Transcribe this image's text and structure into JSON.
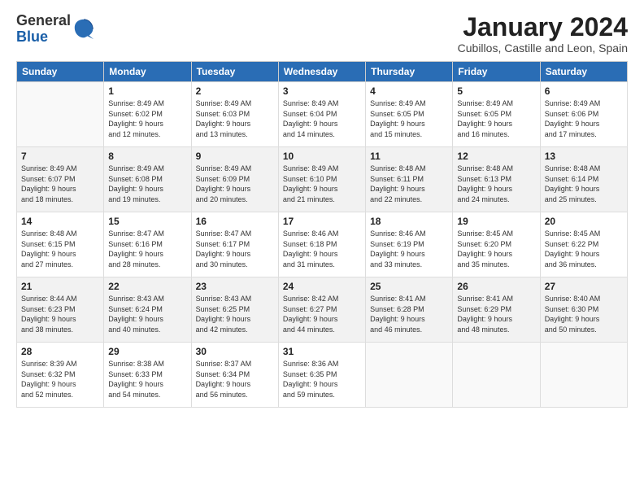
{
  "header": {
    "logo_line1": "General",
    "logo_line2": "Blue",
    "month": "January 2024",
    "location": "Cubillos, Castille and Leon, Spain"
  },
  "days_of_week": [
    "Sunday",
    "Monday",
    "Tuesday",
    "Wednesday",
    "Thursday",
    "Friday",
    "Saturday"
  ],
  "weeks": [
    [
      {
        "num": "",
        "info": ""
      },
      {
        "num": "1",
        "info": "Sunrise: 8:49 AM\nSunset: 6:02 PM\nDaylight: 9 hours\nand 12 minutes."
      },
      {
        "num": "2",
        "info": "Sunrise: 8:49 AM\nSunset: 6:03 PM\nDaylight: 9 hours\nand 13 minutes."
      },
      {
        "num": "3",
        "info": "Sunrise: 8:49 AM\nSunset: 6:04 PM\nDaylight: 9 hours\nand 14 minutes."
      },
      {
        "num": "4",
        "info": "Sunrise: 8:49 AM\nSunset: 6:05 PM\nDaylight: 9 hours\nand 15 minutes."
      },
      {
        "num": "5",
        "info": "Sunrise: 8:49 AM\nSunset: 6:05 PM\nDaylight: 9 hours\nand 16 minutes."
      },
      {
        "num": "6",
        "info": "Sunrise: 8:49 AM\nSunset: 6:06 PM\nDaylight: 9 hours\nand 17 minutes."
      }
    ],
    [
      {
        "num": "7",
        "info": "Sunrise: 8:49 AM\nSunset: 6:07 PM\nDaylight: 9 hours\nand 18 minutes."
      },
      {
        "num": "8",
        "info": "Sunrise: 8:49 AM\nSunset: 6:08 PM\nDaylight: 9 hours\nand 19 minutes."
      },
      {
        "num": "9",
        "info": "Sunrise: 8:49 AM\nSunset: 6:09 PM\nDaylight: 9 hours\nand 20 minutes."
      },
      {
        "num": "10",
        "info": "Sunrise: 8:49 AM\nSunset: 6:10 PM\nDaylight: 9 hours\nand 21 minutes."
      },
      {
        "num": "11",
        "info": "Sunrise: 8:48 AM\nSunset: 6:11 PM\nDaylight: 9 hours\nand 22 minutes."
      },
      {
        "num": "12",
        "info": "Sunrise: 8:48 AM\nSunset: 6:13 PM\nDaylight: 9 hours\nand 24 minutes."
      },
      {
        "num": "13",
        "info": "Sunrise: 8:48 AM\nSunset: 6:14 PM\nDaylight: 9 hours\nand 25 minutes."
      }
    ],
    [
      {
        "num": "14",
        "info": "Sunrise: 8:48 AM\nSunset: 6:15 PM\nDaylight: 9 hours\nand 27 minutes."
      },
      {
        "num": "15",
        "info": "Sunrise: 8:47 AM\nSunset: 6:16 PM\nDaylight: 9 hours\nand 28 minutes."
      },
      {
        "num": "16",
        "info": "Sunrise: 8:47 AM\nSunset: 6:17 PM\nDaylight: 9 hours\nand 30 minutes."
      },
      {
        "num": "17",
        "info": "Sunrise: 8:46 AM\nSunset: 6:18 PM\nDaylight: 9 hours\nand 31 minutes."
      },
      {
        "num": "18",
        "info": "Sunrise: 8:46 AM\nSunset: 6:19 PM\nDaylight: 9 hours\nand 33 minutes."
      },
      {
        "num": "19",
        "info": "Sunrise: 8:45 AM\nSunset: 6:20 PM\nDaylight: 9 hours\nand 35 minutes."
      },
      {
        "num": "20",
        "info": "Sunrise: 8:45 AM\nSunset: 6:22 PM\nDaylight: 9 hours\nand 36 minutes."
      }
    ],
    [
      {
        "num": "21",
        "info": "Sunrise: 8:44 AM\nSunset: 6:23 PM\nDaylight: 9 hours\nand 38 minutes."
      },
      {
        "num": "22",
        "info": "Sunrise: 8:43 AM\nSunset: 6:24 PM\nDaylight: 9 hours\nand 40 minutes."
      },
      {
        "num": "23",
        "info": "Sunrise: 8:43 AM\nSunset: 6:25 PM\nDaylight: 9 hours\nand 42 minutes."
      },
      {
        "num": "24",
        "info": "Sunrise: 8:42 AM\nSunset: 6:27 PM\nDaylight: 9 hours\nand 44 minutes."
      },
      {
        "num": "25",
        "info": "Sunrise: 8:41 AM\nSunset: 6:28 PM\nDaylight: 9 hours\nand 46 minutes."
      },
      {
        "num": "26",
        "info": "Sunrise: 8:41 AM\nSunset: 6:29 PM\nDaylight: 9 hours\nand 48 minutes."
      },
      {
        "num": "27",
        "info": "Sunrise: 8:40 AM\nSunset: 6:30 PM\nDaylight: 9 hours\nand 50 minutes."
      }
    ],
    [
      {
        "num": "28",
        "info": "Sunrise: 8:39 AM\nSunset: 6:32 PM\nDaylight: 9 hours\nand 52 minutes."
      },
      {
        "num": "29",
        "info": "Sunrise: 8:38 AM\nSunset: 6:33 PM\nDaylight: 9 hours\nand 54 minutes."
      },
      {
        "num": "30",
        "info": "Sunrise: 8:37 AM\nSunset: 6:34 PM\nDaylight: 9 hours\nand 56 minutes."
      },
      {
        "num": "31",
        "info": "Sunrise: 8:36 AM\nSunset: 6:35 PM\nDaylight: 9 hours\nand 59 minutes."
      },
      {
        "num": "",
        "info": ""
      },
      {
        "num": "",
        "info": ""
      },
      {
        "num": "",
        "info": ""
      }
    ]
  ]
}
